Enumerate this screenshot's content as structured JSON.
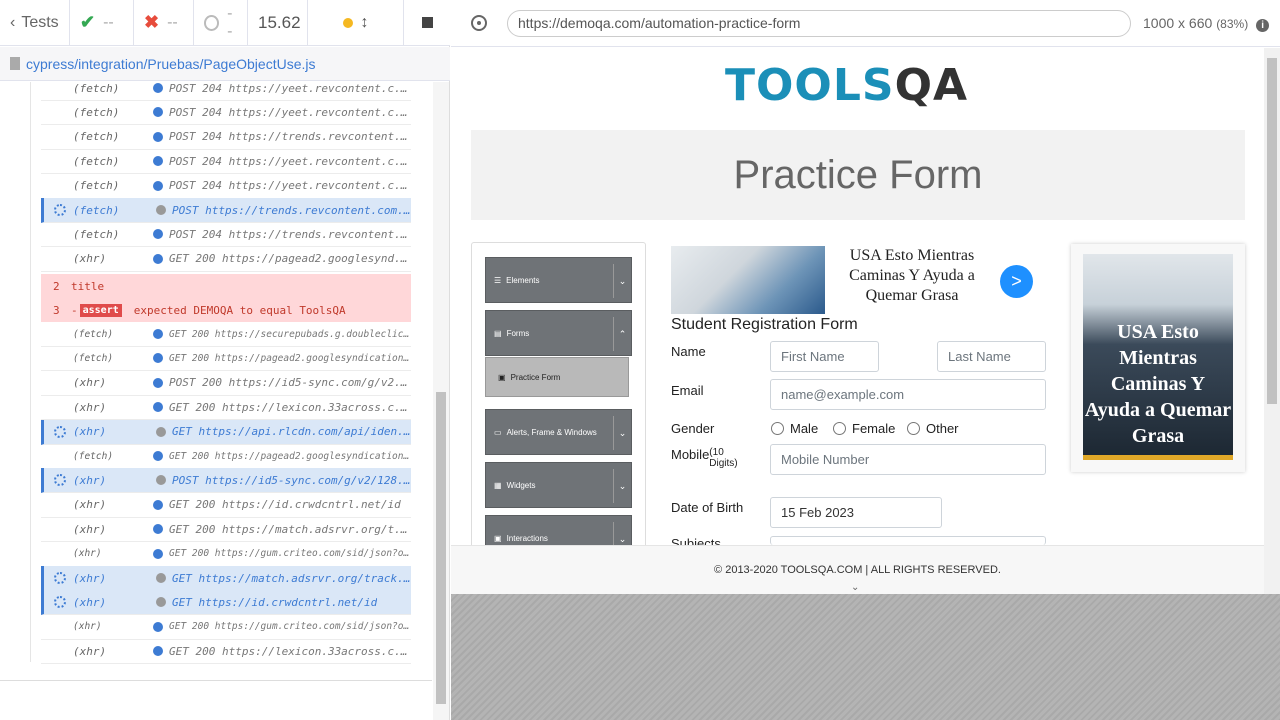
{
  "runner": {
    "tests_label": "Tests",
    "passed": "--",
    "failed": "--",
    "pending": "--",
    "duration": "15.62",
    "spec_path": "cypress/integration/Pruebas/PageObjectUse.js",
    "commands": [
      {
        "type": "(fetch)",
        "msg": "POST 204 https://yeet.revcontent.c...",
        "state": "done",
        "small": false
      },
      {
        "type": "(fetch)",
        "msg": "POST 204 https://yeet.revcontent.c...",
        "state": "done",
        "small": false
      },
      {
        "type": "(fetch)",
        "msg": "POST 204 https://trends.revcontent...",
        "state": "done",
        "small": false
      },
      {
        "type": "(fetch)",
        "msg": "POST 204 https://yeet.revcontent.c...",
        "state": "done",
        "small": false
      },
      {
        "type": "(fetch)",
        "msg": "POST 204 https://yeet.revcontent.c...",
        "state": "done",
        "small": false
      },
      {
        "type": "(fetch)",
        "msg": "POST https://trends.revcontent.com...",
        "state": "pending",
        "small": false
      },
      {
        "type": "(fetch)",
        "msg": "POST 204 https://trends.revcontent...",
        "state": "done",
        "small": false
      },
      {
        "type": "(xhr)",
        "msg": "GET 200 https://pagead2.googlesynd...",
        "state": "done",
        "small": false
      }
    ],
    "error_rows": [
      {
        "num": "2",
        "text": "title"
      },
      {
        "num": "3",
        "prefix": "-",
        "badge": "assert",
        "text": "expected DEMOQA to equal ToolsQA"
      }
    ],
    "commands2": [
      {
        "type": "(fetch)",
        "msg": "GET 200 https://securepubads.g.doubleclic...",
        "state": "done",
        "small": true
      },
      {
        "type": "(fetch)",
        "msg": "GET 200 https://pagead2.googlesyndication...",
        "state": "done",
        "small": true
      },
      {
        "type": "(xhr)",
        "msg": "POST 200 https://id5-sync.com/g/v2...",
        "state": "done",
        "small": false
      },
      {
        "type": "(xhr)",
        "msg": "GET 200 https://lexicon.33across.c...",
        "state": "done",
        "small": false
      },
      {
        "type": "(xhr)",
        "msg": "GET https://api.rlcdn.com/api/iden...",
        "state": "pending",
        "small": false
      },
      {
        "type": "(fetch)",
        "msg": "GET 200 https://pagead2.googlesyndication...",
        "state": "done",
        "small": true
      },
      {
        "type": "(xhr)",
        "msg": "POST https://id5-sync.com/g/v2/128...",
        "state": "pending",
        "small": false
      },
      {
        "type": "(xhr)",
        "msg": "GET 200 https://id.crwdcntrl.net/id",
        "state": "done",
        "small": false
      },
      {
        "type": "(xhr)",
        "msg": "GET 200 https://match.adsrvr.org/t...",
        "state": "done",
        "small": false
      },
      {
        "type": "(xhr)",
        "msg": "GET 200 https://gum.criteo.com/sid/json?o...",
        "state": "done",
        "small": true
      },
      {
        "type": "(xhr)",
        "msg": "GET https://match.adsrvr.org/track...",
        "state": "pending",
        "small": false
      },
      {
        "type": "(xhr)",
        "msg": "GET https://id.crwdcntrl.net/id",
        "state": "pending",
        "small": false
      },
      {
        "type": "(xhr)",
        "msg": "GET 200 https://gum.criteo.com/sid/json?o...",
        "state": "done",
        "small": true
      },
      {
        "type": "(xhr)",
        "msg": "GET 200 https://lexicon.33across.c...",
        "state": "done",
        "small": false
      }
    ]
  },
  "aut": {
    "url": "https://demoqa.com/automation-practice-form",
    "viewport": "1000 x 660",
    "scale": "(83%)",
    "logo_tools": "TOOLS",
    "logo_qa": "QA",
    "banner_title": "Practice Form",
    "sidebar": [
      {
        "label": "Elements"
      },
      {
        "label": "Forms"
      },
      {
        "label": "Practice Form"
      },
      {
        "label": "Alerts, Frame & Windows"
      },
      {
        "label": "Widgets"
      },
      {
        "label": "Interactions"
      }
    ],
    "ad1_text": "USA Esto Mientras Caminas Y Ayuda a Quemar Grasa",
    "ad1_button": ">",
    "form_title": "Student Registration Form",
    "labels": {
      "name": "Name",
      "email": "Email",
      "gender": "Gender",
      "mobile": "Mobile",
      "mobile_hint": "(10 Digits)",
      "dob": "Date of Birth",
      "subjects": "Subjects"
    },
    "placeholders": {
      "first": "First Name",
      "last": "Last Name",
      "email": "name@example.com",
      "mobile": "Mobile Number"
    },
    "dob_value": "15 Feb 2023",
    "genders": [
      "Male",
      "Female",
      "Other"
    ],
    "ad2_text": "USA Esto Mientras Caminas Y Ayuda a Quemar Grasa",
    "footer": "© 2013-2020 TOOLSQA.COM | ALL RIGHTS RESERVED."
  }
}
